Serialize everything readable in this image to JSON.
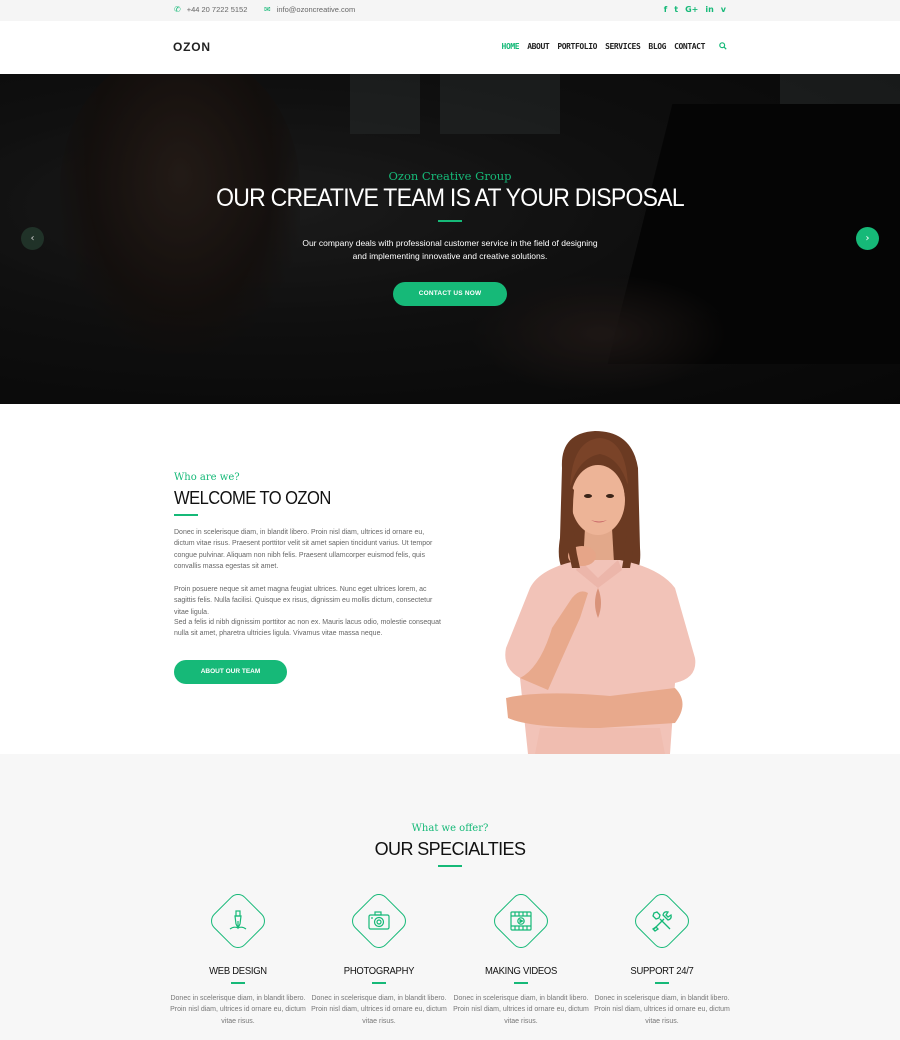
{
  "topbar": {
    "phone": "+44 20 7222 5152",
    "email": "info@ozoncreative.com",
    "socials": [
      "f",
      "t",
      "G+",
      "in",
      "v"
    ]
  },
  "header": {
    "logo": "OZON",
    "nav": [
      "HOME",
      "ABOUT",
      "PORTFOLIO",
      "SERVICES",
      "BLOG",
      "CONTACT"
    ],
    "active": "HOME"
  },
  "hero": {
    "subtitle": "Ozon Creative Group",
    "title": "OUR CREATIVE TEAM IS AT YOUR DISPOSAL",
    "text_line1": "Our company deals with professional customer service in the field of designing",
    "text_line2": "and implementing innovative and creative solutions.",
    "cta": "CONTACT US NOW",
    "prev": "‹",
    "next": "›"
  },
  "about": {
    "subtitle": "Who are we?",
    "title": "WELCOME TO OZON",
    "p1": "Donec in scelerisque diam, in blandit libero. Proin nisl diam, ultrices id ornare eu, dictum vitae risus. Praesent porttitor velit sit amet sapien tincidunt varius. Ut tempor congue pulvinar. Aliquam non nibh felis. Praesent ullamcorper euismod felis, quis convallis massa egestas sit amet.",
    "p2": "Proin posuere neque sit amet magna feugiat ultrices. Nunc eget ultrices lorem, ac sagittis felis. Nulla facilisi. Quisque ex risus, dignissim eu mollis dictum, consectetur vitae ligula.",
    "p3": "Sed a felis id nibh dignissim porttitor ac non ex. Mauris lacus odio, molestie consequat nulla sit amet, pharetra ultricies ligula. Vivamus vitae massa neque.",
    "button": "ABOUT OUR TEAM"
  },
  "specialties": {
    "subtitle": "What we offer?",
    "title": "OUR SPECIALTIES",
    "items": [
      {
        "title": "WEB DESIGN",
        "icon": "pen-nib-icon",
        "text": "Donec in scelerisque diam, in blandit libero. Proin nisl diam, ultrices id ornare eu, dictum vitae risus."
      },
      {
        "title": "PHOTOGRAPHY",
        "icon": "camera-icon",
        "text": "Donec in scelerisque diam, in blandit libero. Proin nisl diam, ultrices id ornare eu, dictum vitae risus."
      },
      {
        "title": "MAKING VIDEOS",
        "icon": "film-icon",
        "text": "Donec in scelerisque diam, in blandit libero. Proin nisl diam, ultrices id ornare eu, dictum vitae risus."
      },
      {
        "title": "SUPPORT 24/7",
        "icon": "tools-icon",
        "text": "Donec in scelerisque diam, in blandit libero. Proin nisl diam, ultrices id ornare eu, dictum vitae risus."
      }
    ]
  },
  "colors": {
    "accent": "#16b978",
    "topbar_bg": "#f5f5f5",
    "section_bg": "#f7f7f7"
  }
}
